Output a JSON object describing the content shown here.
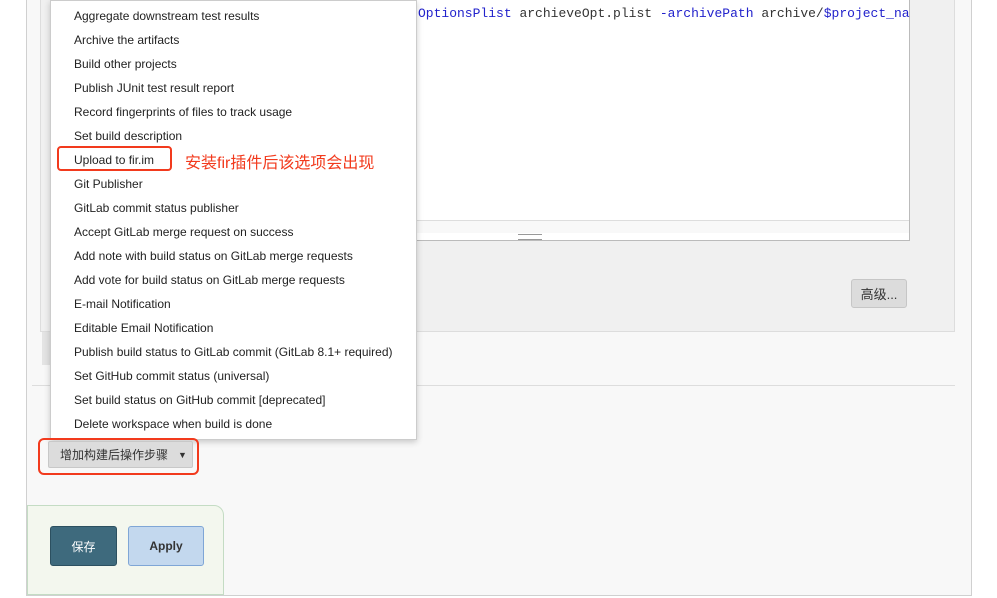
{
  "editor": {
    "code_parts": [
      "OptionsPlist",
      "archieveOpt.plist",
      "-archivePath",
      "archive/",
      "$project_na"
    ]
  },
  "advanced_button": "高级...",
  "menu": {
    "items": [
      "Aggregate downstream test results",
      "Archive the artifacts",
      "Build other projects",
      "Publish JUnit test result report",
      "Record fingerprints of files to track usage",
      "Set build description",
      "Upload to fir.im",
      "Git Publisher",
      "GitLab commit status publisher",
      "Accept GitLab merge request on success",
      "Add note with build status on GitLab merge requests",
      "Add vote for build status on GitLab merge requests",
      "E-mail Notification",
      "Editable Email Notification",
      "Publish build status to GitLab commit (GitLab 8.1+ required)",
      "Set GitHub commit status (universal)",
      "Set build status on GitHub commit [deprecated]",
      "Delete workspace when build is done"
    ]
  },
  "annotation": "安装fir插件后该选项会出现",
  "add_post_build_button": "增加构建后操作步骤",
  "save_button": "保存",
  "apply_button": "Apply",
  "colors": {
    "annotation_red": "#f23a1d",
    "save_bg": "#3e6a7d",
    "apply_bg": "#c3d8ee"
  }
}
